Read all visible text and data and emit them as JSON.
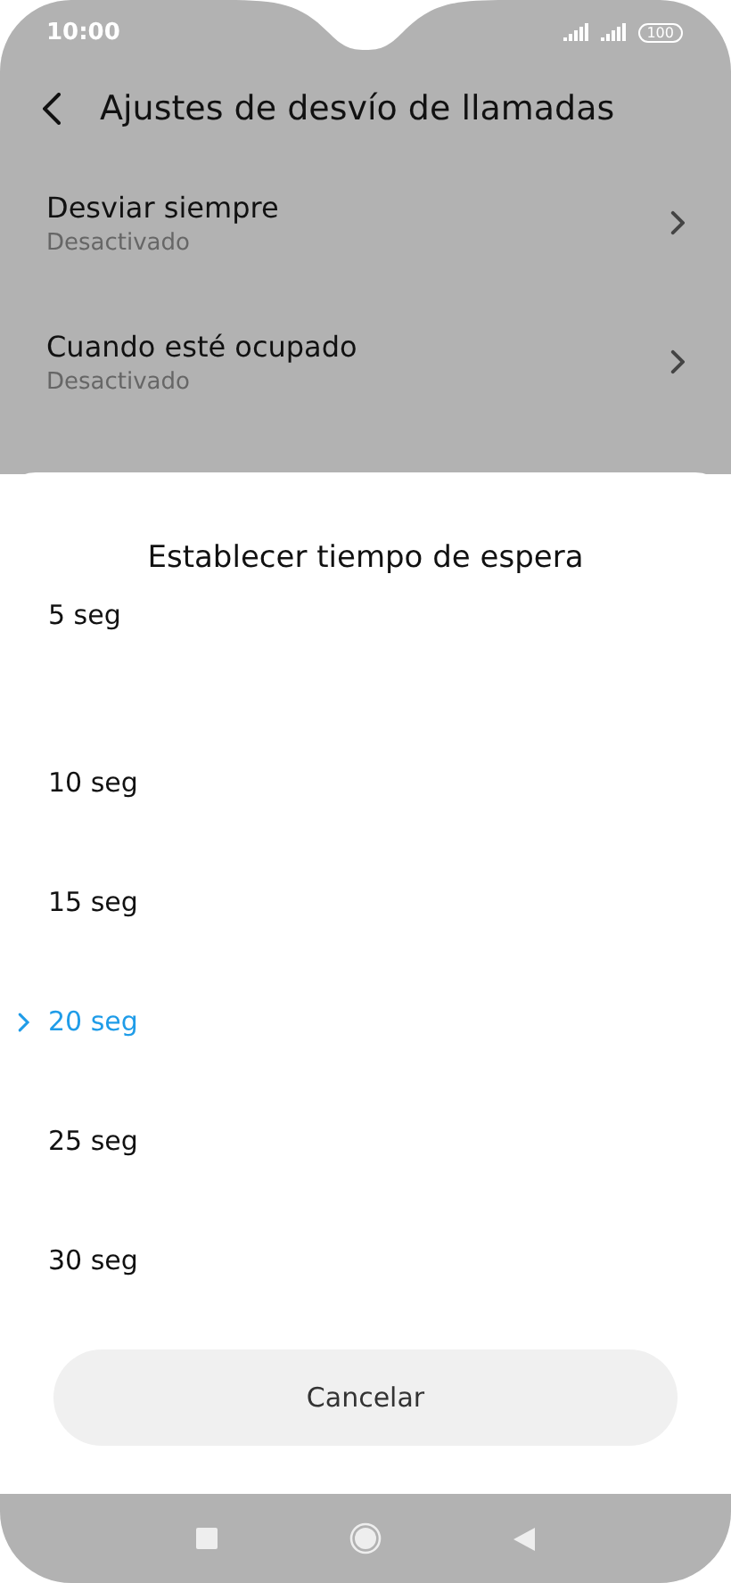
{
  "status_bar": {
    "time": "10:00",
    "battery": "100"
  },
  "header": {
    "title": "Ajustes de desvío de llamadas"
  },
  "settings": [
    {
      "title": "Desviar siempre",
      "subtitle": "Desactivado"
    },
    {
      "title": "Cuando esté ocupado",
      "subtitle": "Desactivado"
    }
  ],
  "dialog": {
    "title": "Establecer tiempo de espera",
    "options": [
      {
        "label": "5 seg",
        "selected": false
      },
      {
        "label": "10 seg",
        "selected": false
      },
      {
        "label": "15 seg",
        "selected": false
      },
      {
        "label": "20 seg",
        "selected": true
      },
      {
        "label": "25 seg",
        "selected": false
      },
      {
        "label": "30 seg",
        "selected": false
      }
    ],
    "cancel": "Cancelar"
  }
}
